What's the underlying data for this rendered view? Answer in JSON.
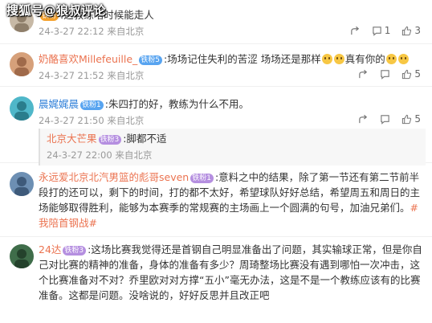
{
  "watermark": "搜狐号@狼叔评论",
  "comments": [
    {
      "name": "",
      "badge": "铁粉",
      "text": ":这教练啥时候能走人",
      "time": "24-3-27 22:12 来自北京",
      "shares": "",
      "replies": "1",
      "likes": "3",
      "avatar_color": "#c7b9a6"
    },
    {
      "name": "奶酪喜欢Millefeuille_",
      "badge": "铁粉5",
      "text_parts": [
        ":场场记住失利的苦涩 场场还是那样",
        "真有你的"
      ],
      "time": "24-3-27 21:52 来自北京",
      "likes": "5",
      "avatar_color": "#d6a07a"
    },
    {
      "name": "晨娓娓晨",
      "badge": "铁粉1",
      "text": ":朱四打的好，教练为什么不用。",
      "time": "24-3-27 21:50 来自北京",
      "likes": "5",
      "avatar_color": "#4fb7c9",
      "reply": {
        "name": "北京大芒果",
        "badge": "铁粉3",
        "text": ":脚都不适",
        "time": "24-3-27 22:00 来自北京"
      }
    },
    {
      "name": "永远爱北京北汽男篮的彪哥seven",
      "badge": "铁粉1",
      "text": ":意料之中的结果，除了第一节还有第二节前半段打的还可以，剩下的时间，打的都不太好，希望球队好好总结，希望周五和周日的主场能够取得胜利，能够为本赛季的常规赛的主场画上一个圆满的句号，加油兄弟们。",
      "tag": "#我陪首钢战#",
      "avatar_color": "#6d8fb3"
    },
    {
      "name": "24达",
      "badge": "铁粉3",
      "text": ":这场比赛我觉得还是首钢自己明显准备出了问题，其实输球正常，但是你自己对比赛的精神的准备，身体的准备有多少？周琦整场比赛没有遇到哪怕一次冲击，这个比赛准备对不对？乔里欧对对方撑“五小”毫无办法，这是不是一个教练应该有的比赛准备。这都是问题。没啥说的，好好反思并且改正吧",
      "avatar_color": "#3f6d4a"
    }
  ],
  "colors": {
    "accent": "#eb7350",
    "meta": "#999999",
    "text": "#333333"
  }
}
